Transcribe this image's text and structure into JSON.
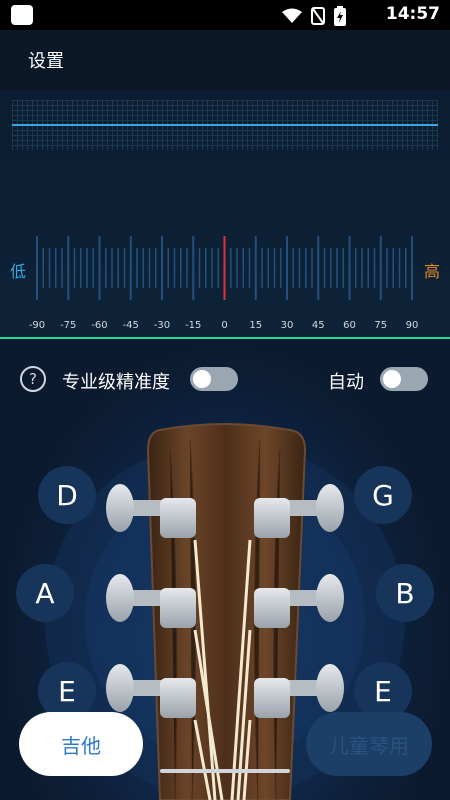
{
  "status_bar": {
    "time": "14:57"
  },
  "header": {
    "title": "设置"
  },
  "tuner": {
    "low_label": "低",
    "high_label": "高",
    "ticks": [
      "-90",
      "-75",
      "-60",
      "-45",
      "-30",
      "-15",
      "0",
      "15",
      "30",
      "45",
      "60",
      "75",
      "90"
    ],
    "needle_value": 0,
    "accent": "#3aa7e2",
    "needle_color": "#e0303a"
  },
  "options": {
    "help": "?",
    "pro_precision_label": "专业级精准度",
    "pro_precision_on": false,
    "auto_label": "自动",
    "auto_on": false
  },
  "strings": {
    "left": [
      "D",
      "A",
      "E"
    ],
    "right": [
      "G",
      "B",
      "E"
    ]
  },
  "tabs": {
    "guitar": "吉他",
    "other": "儿童琴用"
  }
}
